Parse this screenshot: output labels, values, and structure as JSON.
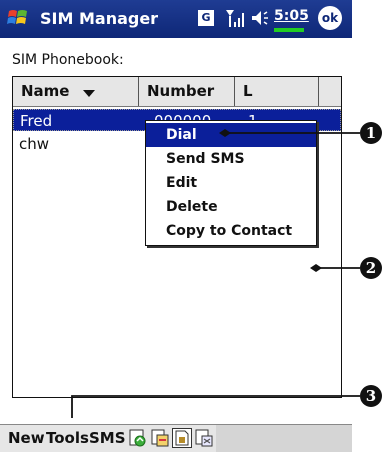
{
  "titlebar": {
    "app_title": "SIM Manager",
    "network_badge": "G",
    "clock": "5:05",
    "ok_label": "ok",
    "colors": {
      "background": "#0e2777",
      "battery": "#22cc22"
    }
  },
  "section_label": "SIM Phonebook:",
  "columns": {
    "name": "Name",
    "number": "Number",
    "l": "L"
  },
  "rows": [
    {
      "name": "Fred",
      "number": "000000",
      "l": "1",
      "selected": true
    },
    {
      "name": "chw",
      "number": "",
      "l": "",
      "selected": false
    }
  ],
  "context_menu": {
    "items": [
      {
        "label": "Dial",
        "highlighted": true
      },
      {
        "label": "Send SMS",
        "highlighted": false
      },
      {
        "label": "Edit",
        "highlighted": false
      },
      {
        "label": "Delete",
        "highlighted": false
      },
      {
        "label": "Copy to Contact",
        "highlighted": false
      }
    ],
    "highlight_color": "#0b1f9a"
  },
  "menubar": {
    "new": "New",
    "tools": "Tools",
    "sms": "SMS",
    "toolbar_icons": [
      "sim-copy-icon",
      "contacts-to-sim-icon",
      "sim-card-icon",
      "sim-to-contacts-icon"
    ]
  },
  "callouts": [
    "1",
    "2",
    "3"
  ]
}
